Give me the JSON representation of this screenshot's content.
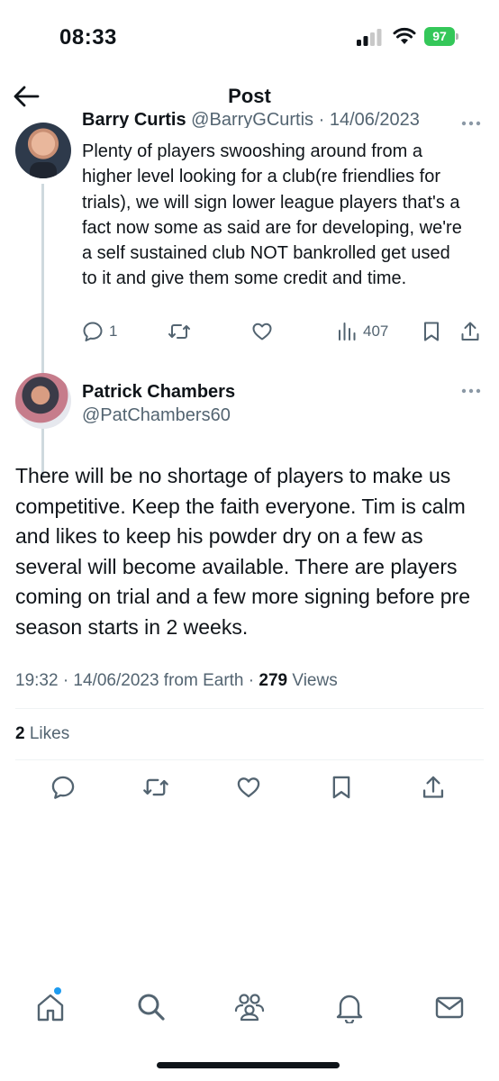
{
  "status_bar": {
    "time": "08:33",
    "battery": "97"
  },
  "header": {
    "title": "Post"
  },
  "parent_tweet": {
    "author_name": "Barry Curtis",
    "handle": "@BarryGCurtis",
    "date": "· 14/06/2023",
    "text": "Plenty of players swooshing around from a higher level looking for a club(re friendlies for trials), we will sign lower league players that's a fact now some as said are for developing, we're a self sustained club NOT bankrolled get used to it and give them some credit and time.",
    "reply_count": "1",
    "view_count": "407"
  },
  "main_tweet": {
    "author_name": "Patrick Chambers",
    "handle": "@PatChambers60",
    "text": "There will be no shortage of players to make us competitive.  Keep the faith everyone. Tim is calm and likes to keep his powder dry on a few as several will become available. There are players coming on trial and a few more signing before pre season starts in 2 weeks.",
    "meta_time": "19:32 · 14/06/2023 from Earth · ",
    "view_count": "279",
    "views_label": " Views",
    "likes_count": "2",
    "likes_label": " Likes"
  },
  "icons": {
    "back": "arrow-left-icon",
    "more": "more-horizontal-icon",
    "reply": "reply-icon",
    "repost": "repost-icon",
    "like": "heart-icon",
    "views": "views-icon",
    "bookmark": "bookmark-icon",
    "share": "share-icon",
    "nav": [
      "home-icon",
      "search-icon",
      "communities-icon",
      "notifications-icon",
      "messages-icon"
    ]
  },
  "colors": {
    "text": "#0f1419",
    "secondary": "#536471",
    "accent": "#1d9bf0",
    "battery": "#34c759"
  }
}
